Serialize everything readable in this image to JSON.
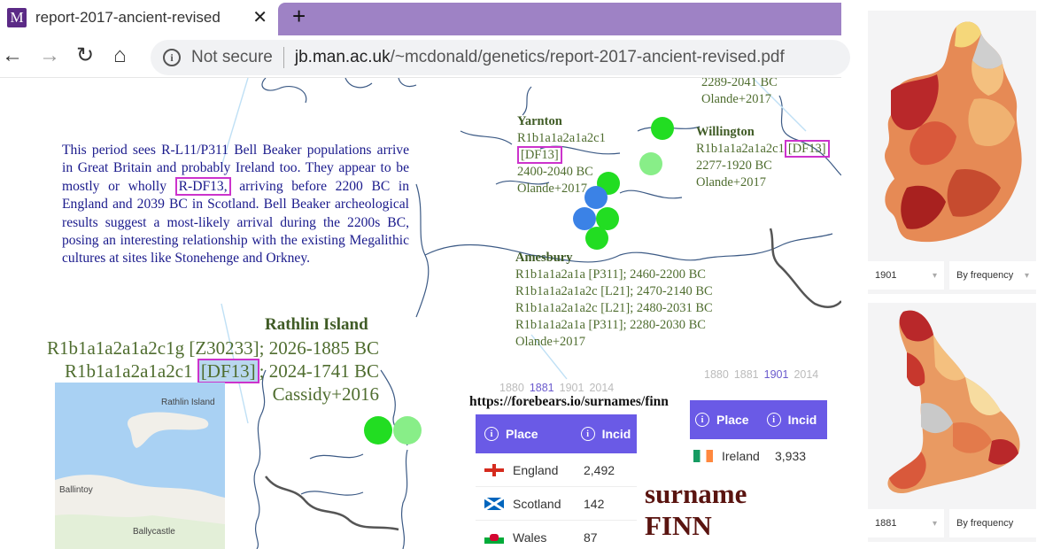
{
  "browser": {
    "tab_title": "report-2017-ancient-revised",
    "favicon_letter": "M",
    "close_glyph": "✕",
    "newtab_glyph": "+",
    "not_secure": "Not secure",
    "url_host": "jb.man.ac.uk",
    "url_path": "/~mcdonald/genetics/report-2017-ancient-revised.pdf",
    "nav": {
      "back": "←",
      "forward": "→",
      "reload": "↻",
      "home": "⌂",
      "info": "i"
    }
  },
  "pdf": {
    "paragraph": {
      "before": "This period sees R-L11/P311 Bell Beaker populations arrive in Great Britain and probably Ireland too. They appear to be mostly or wholly ",
      "highlight": "R-DF13,",
      "after": " arriving before 2200 BC in England and 2039 BC in Scotland. Bell Beaker archeological results suggest a most-likely arrival during the 2200s BC, posing an interesting relationship with the existing Megalithic cultures at sites like Stonehenge and Orkney."
    },
    "top_partial": {
      "line1": "2289-2041 BC",
      "line2": "Olande+2017"
    },
    "yarnton": {
      "title": "Yarnton",
      "line1": "R1b1a1a2a1a2c1",
      "line2": "[DF13]",
      "line3": "2400-2040 BC",
      "line4": "Olande+2017"
    },
    "willington": {
      "title": "Willington",
      "line1": "R1b1a1a2a1a2c1",
      "line1_box": "[DF13]",
      "line2": "2277-1920 BC",
      "line3": "Olande+2017"
    },
    "amesbury": {
      "title": "Amesbury",
      "lines": [
        "R1b1a1a2a1a [P311]; 2460-2200 BC",
        "R1b1a1a2a1a2c [L21]; 2470-2140 BC",
        "R1b1a1a2a1a2c [L21]; 2480-2031 BC",
        "R1b1a1a2a1a [P311]; 2280-2030 BC",
        "Olande+2017"
      ]
    },
    "rathlin": {
      "title": "Rathlin Island",
      "line1": "R1b1a1a2a1a2c1g [Z30233]; 2026-1885 BC",
      "line2_pre": "R1b1a1a2a1a2c1 ",
      "line2_hl": "[DF13]",
      "line2_post": "; 2024-1741 BC",
      "line3": "Cassidy+2016"
    },
    "minimap_labels": {
      "island": "Rathlin Island",
      "ballintoy": "Ballintoy",
      "ballycastle": "Ballycastle"
    }
  },
  "forebears": {
    "url": "https://forebears.io/surnames/finn",
    "years_left": [
      "1880",
      "1881",
      "1901",
      "2014"
    ],
    "years_left_active": "1881",
    "years_right": [
      "1880",
      "1881",
      "1901",
      "2014"
    ],
    "years_right_active": "1901",
    "left_table": {
      "col_place": "Place",
      "col_incid": "Incid",
      "rows": [
        {
          "place": "England",
          "incidence": "2,492",
          "flag": "england"
        },
        {
          "place": "Scotland",
          "incidence": "142",
          "flag": "scotland"
        },
        {
          "place": "Wales",
          "incidence": "87",
          "flag": "wales"
        }
      ]
    },
    "right_table": {
      "col_place": "Place",
      "col_incid": "Incid",
      "rows": [
        {
          "place": "Ireland",
          "incidence": "3,933",
          "flag": "ireland"
        }
      ]
    },
    "surname_line1": "surname",
    "surname_line2": "FINN"
  },
  "maps": {
    "ireland": {
      "year": "1901",
      "mode": "By frequency"
    },
    "england": {
      "year": "1881",
      "mode": "By frequency"
    }
  },
  "colors": {
    "accent": "#6a5ae6",
    "dot_green": "#22dd22",
    "dot_light_green": "#88ee88",
    "dot_blue": "#3b82e6",
    "box": "#cc33cc"
  }
}
